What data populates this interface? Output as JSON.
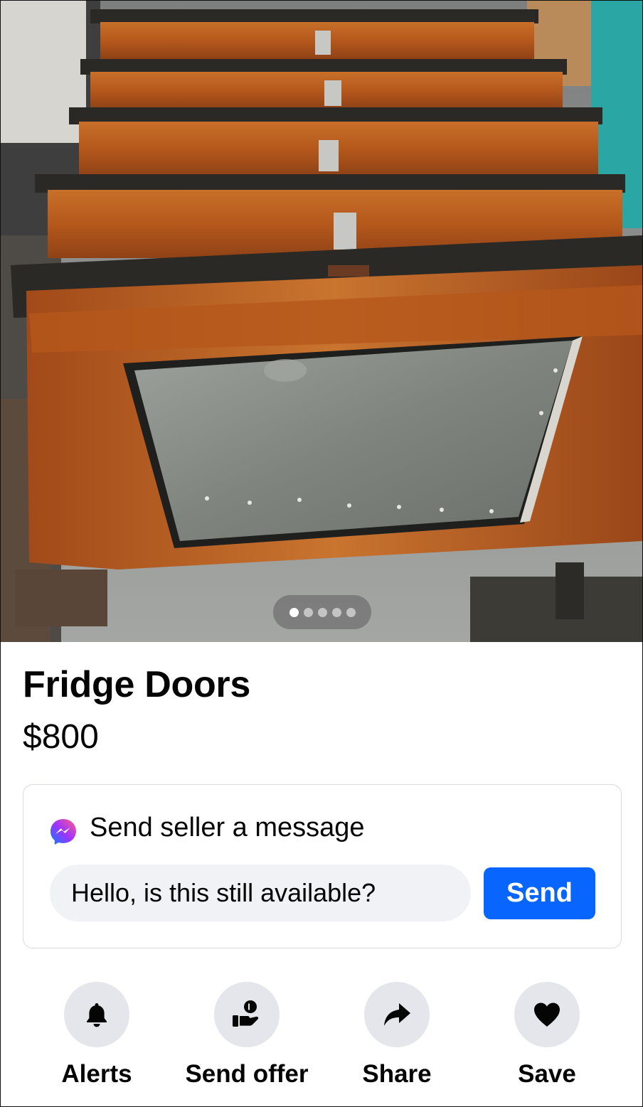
{
  "listing": {
    "title": "Fridge Doors",
    "price": "$800",
    "photo": {
      "description_icon": "listing-photo",
      "pager": {
        "count": 5,
        "active_index": 0
      }
    }
  },
  "message_card": {
    "title": "Send seller a message",
    "icon": "messenger-icon",
    "input_value": "Hello, is this still available?",
    "send_label": "Send"
  },
  "actions": [
    {
      "label": "Alerts",
      "icon": "bell-icon"
    },
    {
      "label": "Send offer",
      "icon": "offer-icon"
    },
    {
      "label": "Share",
      "icon": "share-arrow-icon"
    },
    {
      "label": "Save",
      "icon": "heart-icon"
    }
  ],
  "colors": {
    "accent": "#0866ff",
    "text": "#050505",
    "chip_bg": "#e4e6eb",
    "input_bg": "#f0f2f5",
    "card_border": "#d8dadf"
  }
}
